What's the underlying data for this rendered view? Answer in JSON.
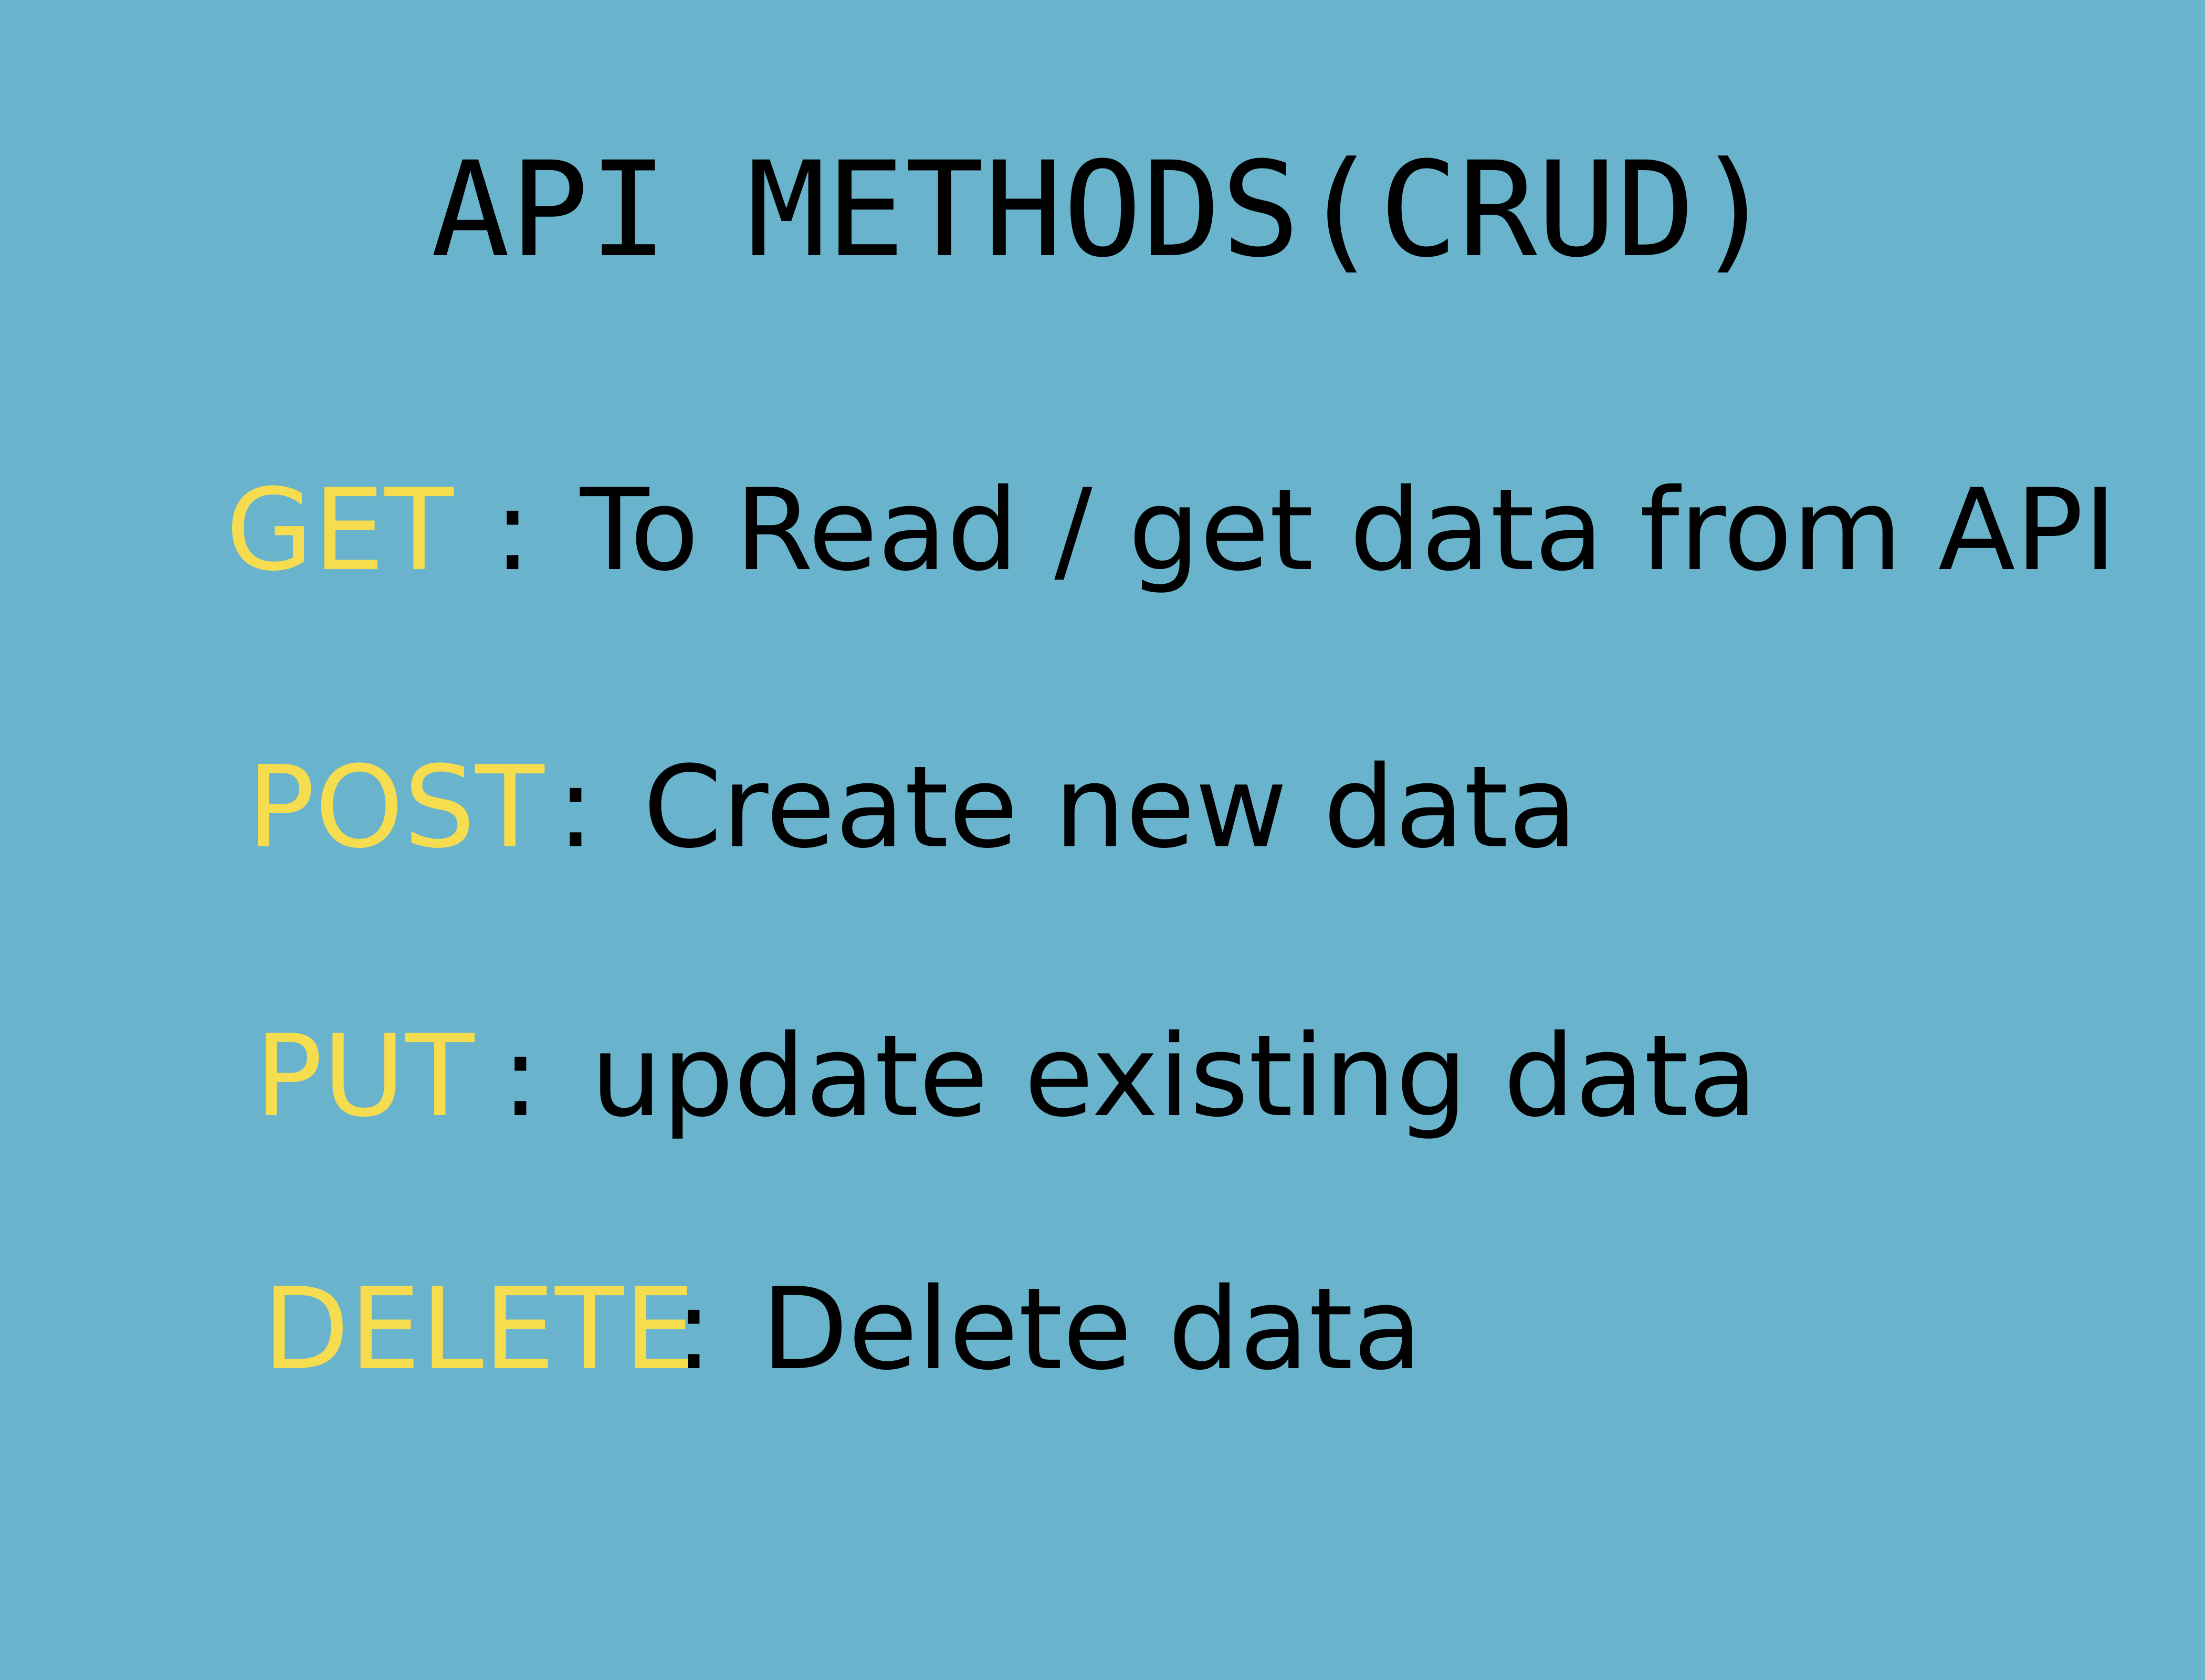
{
  "title": "API METHODS(CRUD)",
  "separator": ":",
  "methods": [
    {
      "name": "GET",
      "description": "To Read / get data from API"
    },
    {
      "name": "POST",
      "description": "Create new data"
    },
    {
      "name": "PUT",
      "description": "update existing data"
    },
    {
      "name": "DELETE",
      "description": "Delete data"
    }
  ],
  "colors": {
    "background": "#69b4cc",
    "method": "#f6dc4f",
    "text": "#000000"
  }
}
